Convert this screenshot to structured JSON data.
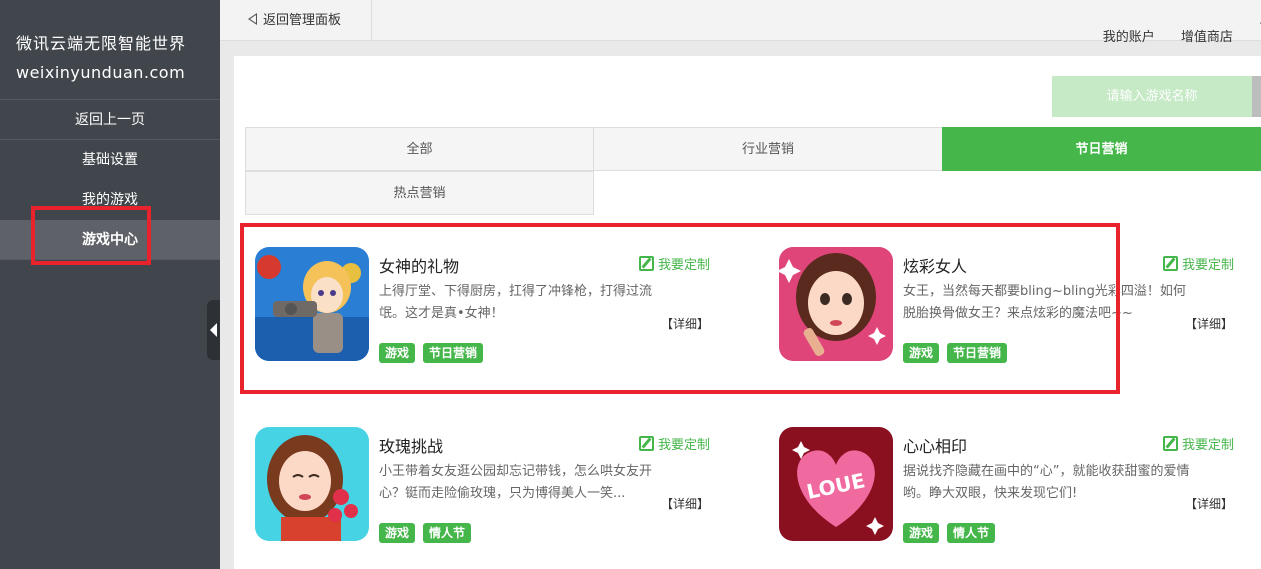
{
  "sidebar": {
    "brand_cn": "微讯云端无限智能世界",
    "brand_en": "weixinyunduan.com",
    "items": [
      {
        "label": "返回上一页"
      },
      {
        "label": "基础设置"
      },
      {
        "label": "我的游戏"
      },
      {
        "label": "游戏中心"
      }
    ]
  },
  "topbar": {
    "back_label": "返回管理面板",
    "links": [
      "我的账户",
      "增值商店",
      "…"
    ]
  },
  "search": {
    "placeholder": "请输入游戏名称"
  },
  "tabs": [
    {
      "label": "全部",
      "active": false
    },
    {
      "label": "行业营销",
      "active": false
    },
    {
      "label": "节日营销",
      "active": true
    },
    {
      "label": "热点营销",
      "active": false
    }
  ],
  "games": [
    {
      "title": "女神的礼物",
      "customize": "我要定制",
      "desc": "上得厅堂、下得厨房，扛得了冲锋枪，打得过流氓。这才是真•女神！",
      "detail": "【详细】",
      "tags": [
        "游戏",
        "节日营销"
      ]
    },
    {
      "title": "炫彩女人",
      "customize": "我要定制",
      "desc": "女王，当然每天都要bling~bling光彩四溢！如何脱胎换骨做女王？来点炫彩的魔法吧~~",
      "detail": "【详细】",
      "tags": [
        "游戏",
        "节日营销"
      ]
    },
    {
      "title": "玫瑰挑战",
      "customize": "我要定制",
      "desc": "小王带着女友逛公园却忘记带钱，怎么哄女友开心？铤而走险偷玫瑰，只为博得美人一笑...",
      "detail": "【详细】",
      "tags": [
        "游戏",
        "情人节"
      ]
    },
    {
      "title": "心心相印",
      "customize": "我要定制",
      "desc": "据说找齐隐藏在画中的“心”，就能收获甜蜜的爱情哟。睁大双眼，快来发现它们!",
      "detail": "【详细】",
      "tags": [
        "游戏",
        "情人节"
      ]
    }
  ],
  "thumb_text": {
    "heart": "LOUE"
  },
  "colors": {
    "accent": "#45b64a",
    "sidebar": "#41464c",
    "highlight": "#e8232b"
  }
}
